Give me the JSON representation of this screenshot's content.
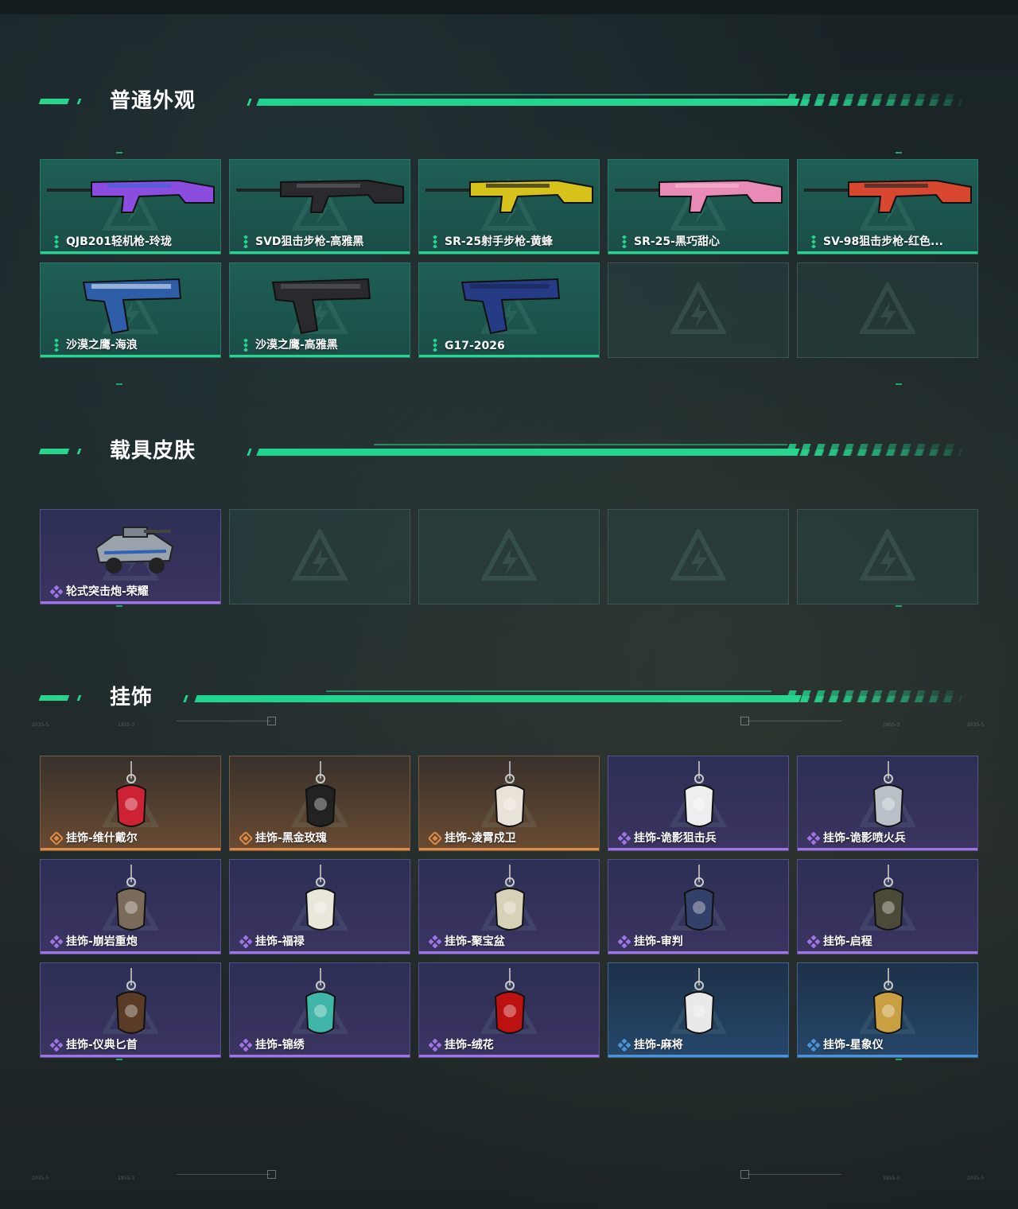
{
  "sections": [
    {
      "title": "普通外观",
      "items": [
        {
          "label": "QJB201轻机枪-玲珑",
          "rarity": "green",
          "icon": "lmg-icon"
        },
        {
          "label": "SVD狙击步枪-高雅黑",
          "rarity": "green",
          "icon": "sniper-rifle-icon"
        },
        {
          "label": "SR-25射手步枪-黄蜂",
          "rarity": "green",
          "icon": "marksman-rifle-icon"
        },
        {
          "label": "SR-25-黑巧甜心",
          "rarity": "green",
          "icon": "marksman-rifle-icon"
        },
        {
          "label": "SV-98狙击步枪-红色...",
          "rarity": "green",
          "icon": "sniper-rifle-icon"
        },
        {
          "label": "沙漠之鹰-海浪",
          "rarity": "green",
          "icon": "pistol-icon"
        },
        {
          "label": "沙漠之鹰-高雅黑",
          "rarity": "green",
          "icon": "pistol-icon"
        },
        {
          "label": "G17-2026",
          "rarity": "green",
          "icon": "pistol-icon"
        }
      ]
    },
    {
      "title": "载具皮肤",
      "items": [
        {
          "label": "轮式突击炮-荣耀",
          "rarity": "purple",
          "icon": "vehicle-icon"
        }
      ]
    },
    {
      "title": "挂饰",
      "items": [
        {
          "label": "挂饰-维什戴尔",
          "rarity": "orange",
          "icon": "charm-icon"
        },
        {
          "label": "挂饰-黑金玫瑰",
          "rarity": "orange",
          "icon": "charm-icon"
        },
        {
          "label": "挂饰-凌霄戍卫",
          "rarity": "orange",
          "icon": "charm-icon"
        },
        {
          "label": "挂饰-诡影狙击兵",
          "rarity": "purple",
          "icon": "charm-icon"
        },
        {
          "label": "挂饰-诡影喷火兵",
          "rarity": "purple",
          "icon": "charm-icon"
        },
        {
          "label": "挂饰-崩岩重炮",
          "rarity": "purple",
          "icon": "charm-icon"
        },
        {
          "label": "挂饰-福禄",
          "rarity": "purple",
          "icon": "charm-icon"
        },
        {
          "label": "挂饰-聚宝盆",
          "rarity": "purple",
          "icon": "charm-icon"
        },
        {
          "label": "挂饰-审判",
          "rarity": "purple",
          "icon": "charm-icon"
        },
        {
          "label": "挂饰-启程",
          "rarity": "purple",
          "icon": "charm-icon"
        },
        {
          "label": "挂饰-仪典匕首",
          "rarity": "purple",
          "icon": "charm-icon"
        },
        {
          "label": "挂饰-锦绣",
          "rarity": "purple",
          "icon": "charm-icon"
        },
        {
          "label": "挂饰-绒花",
          "rarity": "purple",
          "icon": "charm-icon"
        },
        {
          "label": "挂饰-麻将",
          "rarity": "blue",
          "icon": "charm-icon"
        },
        {
          "label": "挂饰-星象仪",
          "rarity": "blue",
          "icon": "charm-icon"
        }
      ]
    }
  ],
  "colors": {
    "accent": "#27d58f",
    "rarity_green": "#27d58f",
    "rarity_purple": "#9f74e5",
    "rarity_orange": "#e08b45",
    "rarity_blue": "#4b93d6"
  },
  "deco_text": {
    "code_a": "2035-5",
    "code_b": "1955-3"
  }
}
